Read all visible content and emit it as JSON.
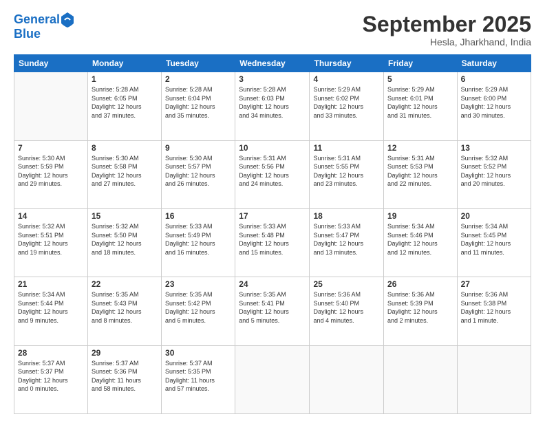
{
  "header": {
    "logo_line1": "General",
    "logo_line2": "Blue",
    "month": "September 2025",
    "location": "Hesla, Jharkhand, India"
  },
  "weekdays": [
    "Sunday",
    "Monday",
    "Tuesday",
    "Wednesday",
    "Thursday",
    "Friday",
    "Saturday"
  ],
  "weeks": [
    [
      {
        "day": "",
        "info": ""
      },
      {
        "day": "1",
        "info": "Sunrise: 5:28 AM\nSunset: 6:05 PM\nDaylight: 12 hours\nand 37 minutes."
      },
      {
        "day": "2",
        "info": "Sunrise: 5:28 AM\nSunset: 6:04 PM\nDaylight: 12 hours\nand 35 minutes."
      },
      {
        "day": "3",
        "info": "Sunrise: 5:28 AM\nSunset: 6:03 PM\nDaylight: 12 hours\nand 34 minutes."
      },
      {
        "day": "4",
        "info": "Sunrise: 5:29 AM\nSunset: 6:02 PM\nDaylight: 12 hours\nand 33 minutes."
      },
      {
        "day": "5",
        "info": "Sunrise: 5:29 AM\nSunset: 6:01 PM\nDaylight: 12 hours\nand 31 minutes."
      },
      {
        "day": "6",
        "info": "Sunrise: 5:29 AM\nSunset: 6:00 PM\nDaylight: 12 hours\nand 30 minutes."
      }
    ],
    [
      {
        "day": "7",
        "info": "Sunrise: 5:30 AM\nSunset: 5:59 PM\nDaylight: 12 hours\nand 29 minutes."
      },
      {
        "day": "8",
        "info": "Sunrise: 5:30 AM\nSunset: 5:58 PM\nDaylight: 12 hours\nand 27 minutes."
      },
      {
        "day": "9",
        "info": "Sunrise: 5:30 AM\nSunset: 5:57 PM\nDaylight: 12 hours\nand 26 minutes."
      },
      {
        "day": "10",
        "info": "Sunrise: 5:31 AM\nSunset: 5:56 PM\nDaylight: 12 hours\nand 24 minutes."
      },
      {
        "day": "11",
        "info": "Sunrise: 5:31 AM\nSunset: 5:55 PM\nDaylight: 12 hours\nand 23 minutes."
      },
      {
        "day": "12",
        "info": "Sunrise: 5:31 AM\nSunset: 5:53 PM\nDaylight: 12 hours\nand 22 minutes."
      },
      {
        "day": "13",
        "info": "Sunrise: 5:32 AM\nSunset: 5:52 PM\nDaylight: 12 hours\nand 20 minutes."
      }
    ],
    [
      {
        "day": "14",
        "info": "Sunrise: 5:32 AM\nSunset: 5:51 PM\nDaylight: 12 hours\nand 19 minutes."
      },
      {
        "day": "15",
        "info": "Sunrise: 5:32 AM\nSunset: 5:50 PM\nDaylight: 12 hours\nand 18 minutes."
      },
      {
        "day": "16",
        "info": "Sunrise: 5:33 AM\nSunset: 5:49 PM\nDaylight: 12 hours\nand 16 minutes."
      },
      {
        "day": "17",
        "info": "Sunrise: 5:33 AM\nSunset: 5:48 PM\nDaylight: 12 hours\nand 15 minutes."
      },
      {
        "day": "18",
        "info": "Sunrise: 5:33 AM\nSunset: 5:47 PM\nDaylight: 12 hours\nand 13 minutes."
      },
      {
        "day": "19",
        "info": "Sunrise: 5:34 AM\nSunset: 5:46 PM\nDaylight: 12 hours\nand 12 minutes."
      },
      {
        "day": "20",
        "info": "Sunrise: 5:34 AM\nSunset: 5:45 PM\nDaylight: 12 hours\nand 11 minutes."
      }
    ],
    [
      {
        "day": "21",
        "info": "Sunrise: 5:34 AM\nSunset: 5:44 PM\nDaylight: 12 hours\nand 9 minutes."
      },
      {
        "day": "22",
        "info": "Sunrise: 5:35 AM\nSunset: 5:43 PM\nDaylight: 12 hours\nand 8 minutes."
      },
      {
        "day": "23",
        "info": "Sunrise: 5:35 AM\nSunset: 5:42 PM\nDaylight: 12 hours\nand 6 minutes."
      },
      {
        "day": "24",
        "info": "Sunrise: 5:35 AM\nSunset: 5:41 PM\nDaylight: 12 hours\nand 5 minutes."
      },
      {
        "day": "25",
        "info": "Sunrise: 5:36 AM\nSunset: 5:40 PM\nDaylight: 12 hours\nand 4 minutes."
      },
      {
        "day": "26",
        "info": "Sunrise: 5:36 AM\nSunset: 5:39 PM\nDaylight: 12 hours\nand 2 minutes."
      },
      {
        "day": "27",
        "info": "Sunrise: 5:36 AM\nSunset: 5:38 PM\nDaylight: 12 hours\nand 1 minute."
      }
    ],
    [
      {
        "day": "28",
        "info": "Sunrise: 5:37 AM\nSunset: 5:37 PM\nDaylight: 12 hours\nand 0 minutes."
      },
      {
        "day": "29",
        "info": "Sunrise: 5:37 AM\nSunset: 5:36 PM\nDaylight: 11 hours\nand 58 minutes."
      },
      {
        "day": "30",
        "info": "Sunrise: 5:37 AM\nSunset: 5:35 PM\nDaylight: 11 hours\nand 57 minutes."
      },
      {
        "day": "",
        "info": ""
      },
      {
        "day": "",
        "info": ""
      },
      {
        "day": "",
        "info": ""
      },
      {
        "day": "",
        "info": ""
      }
    ]
  ]
}
